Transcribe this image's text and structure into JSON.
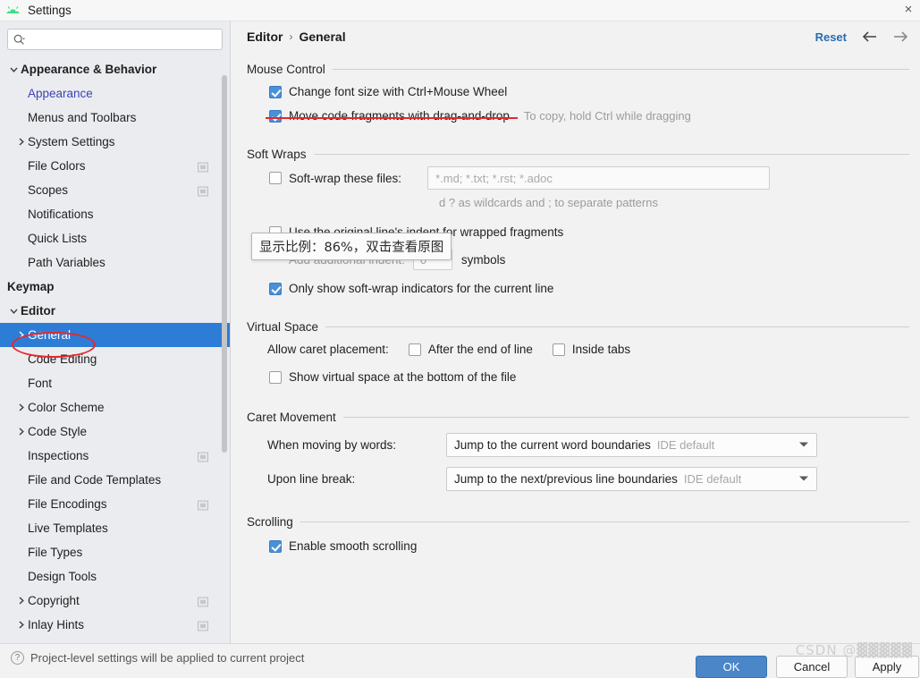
{
  "window": {
    "title": "Settings",
    "app_icon": "android-studio-icon",
    "close_label": "×"
  },
  "search": {
    "value": "",
    "placeholder": "",
    "icon": "search-icon"
  },
  "sidebar": {
    "items": [
      {
        "label": "Appearance & Behavior",
        "depth": 0,
        "bold": true,
        "arrow": "down",
        "link": false,
        "badge": false,
        "selected": false
      },
      {
        "label": "Appearance",
        "depth": 1,
        "bold": false,
        "arrow": "none",
        "link": true,
        "badge": false,
        "selected": false
      },
      {
        "label": "Menus and Toolbars",
        "depth": 1,
        "bold": false,
        "arrow": "none",
        "link": false,
        "badge": false,
        "selected": false
      },
      {
        "label": "System Settings",
        "depth": 1,
        "bold": false,
        "arrow": "right",
        "link": false,
        "badge": false,
        "selected": false
      },
      {
        "label": "File Colors",
        "depth": 1,
        "bold": false,
        "arrow": "none",
        "link": false,
        "badge": true,
        "selected": false
      },
      {
        "label": "Scopes",
        "depth": 1,
        "bold": false,
        "arrow": "none",
        "link": false,
        "badge": true,
        "selected": false
      },
      {
        "label": "Notifications",
        "depth": 1,
        "bold": false,
        "arrow": "none",
        "link": false,
        "badge": false,
        "selected": false
      },
      {
        "label": "Quick Lists",
        "depth": 1,
        "bold": false,
        "arrow": "none",
        "link": false,
        "badge": false,
        "selected": false
      },
      {
        "label": "Path Variables",
        "depth": 1,
        "bold": false,
        "arrow": "none",
        "link": false,
        "badge": false,
        "selected": false
      },
      {
        "label": "Keymap",
        "depth": 0,
        "bold": true,
        "arrow": "none",
        "link": false,
        "badge": false,
        "selected": false
      },
      {
        "label": "Editor",
        "depth": 0,
        "bold": true,
        "arrow": "down",
        "link": false,
        "badge": false,
        "selected": false
      },
      {
        "label": "General",
        "depth": 1,
        "bold": false,
        "arrow": "right",
        "link": false,
        "badge": false,
        "selected": true
      },
      {
        "label": "Code Editing",
        "depth": 1,
        "bold": false,
        "arrow": "none",
        "link": false,
        "badge": false,
        "selected": false
      },
      {
        "label": "Font",
        "depth": 1,
        "bold": false,
        "arrow": "none",
        "link": false,
        "badge": false,
        "selected": false
      },
      {
        "label": "Color Scheme",
        "depth": 1,
        "bold": false,
        "arrow": "right",
        "link": false,
        "badge": false,
        "selected": false
      },
      {
        "label": "Code Style",
        "depth": 1,
        "bold": false,
        "arrow": "right",
        "link": false,
        "badge": false,
        "selected": false
      },
      {
        "label": "Inspections",
        "depth": 1,
        "bold": false,
        "arrow": "none",
        "link": false,
        "badge": true,
        "selected": false
      },
      {
        "label": "File and Code Templates",
        "depth": 1,
        "bold": false,
        "arrow": "none",
        "link": false,
        "badge": false,
        "selected": false
      },
      {
        "label": "File Encodings",
        "depth": 1,
        "bold": false,
        "arrow": "none",
        "link": false,
        "badge": true,
        "selected": false
      },
      {
        "label": "Live Templates",
        "depth": 1,
        "bold": false,
        "arrow": "none",
        "link": false,
        "badge": false,
        "selected": false
      },
      {
        "label": "File Types",
        "depth": 1,
        "bold": false,
        "arrow": "none",
        "link": false,
        "badge": false,
        "selected": false
      },
      {
        "label": "Design Tools",
        "depth": 1,
        "bold": false,
        "arrow": "none",
        "link": false,
        "badge": false,
        "selected": false
      },
      {
        "label": "Copyright",
        "depth": 1,
        "bold": false,
        "arrow": "right",
        "link": false,
        "badge": true,
        "selected": false
      },
      {
        "label": "Inlay Hints",
        "depth": 1,
        "bold": false,
        "arrow": "right",
        "link": false,
        "badge": true,
        "selected": false
      }
    ]
  },
  "header": {
    "breadcrumb_root": "Editor",
    "breadcrumb_sep": "›",
    "breadcrumb_leaf": "General",
    "reset_label": "Reset",
    "back_icon": "arrow-left-icon",
    "forward_icon": "arrow-right-icon"
  },
  "sections": {
    "mouse_control": {
      "title": "Mouse Control",
      "change_font_size": {
        "label": "Change font size with Ctrl+Mouse Wheel",
        "checked": true
      },
      "move_fragments": {
        "label": "Move code fragments with drag-and-drop",
        "checked": true,
        "hint": "To copy, hold Ctrl while dragging"
      }
    },
    "soft_wraps": {
      "title": "Soft Wraps",
      "soft_wrap_files": {
        "label": "Soft-wrap these files:",
        "checked": false,
        "value": "",
        "placeholder": "*.md; *.txt; *.rst; *.adoc"
      },
      "wildcard_hint": "d ? as wildcards and ; to separate patterns",
      "original_indent": {
        "label": "Use the original line's indent for wrapped fragments",
        "checked": false
      },
      "additional_indent": {
        "label": "Add additional indent:",
        "value": "0",
        "unit": "symbols"
      },
      "only_current_line": {
        "label": "Only show soft-wrap indicators for the current line",
        "checked": true
      }
    },
    "virtual_space": {
      "title": "Virtual Space",
      "caret_placement_label": "Allow caret placement:",
      "after_end_of_line": {
        "label": "After the end of line",
        "checked": false
      },
      "inside_tabs": {
        "label": "Inside tabs",
        "checked": false
      },
      "show_virtual_space": {
        "label": "Show virtual space at the bottom of the file",
        "checked": false
      }
    },
    "caret_movement": {
      "title": "Caret Movement",
      "when_moving_by_words": {
        "label": "When moving by words:",
        "value": "Jump to the current word boundaries",
        "suffix": "IDE default"
      },
      "upon_line_break": {
        "label": "Upon line break:",
        "value": "Jump to the next/previous line boundaries",
        "suffix": "IDE default"
      }
    },
    "scrolling": {
      "title": "Scrolling",
      "smooth_scrolling": {
        "label": "Enable smooth scrolling",
        "checked": true
      }
    }
  },
  "footer": {
    "note_icon": "question-mark-icon",
    "note": "Project-level settings will be applied to current project",
    "ok_label": "OK",
    "cancel_label": "Cancel",
    "apply_label": "Apply"
  },
  "annotations": {
    "tooltip_text": "显示比例：86%，双击查看原图",
    "watermark": "CSDN @▓▓▓▓▓",
    "highlight_color": "#e8272c",
    "selection_color": "#2d7cd6",
    "link_color": "#2b6cb0"
  }
}
